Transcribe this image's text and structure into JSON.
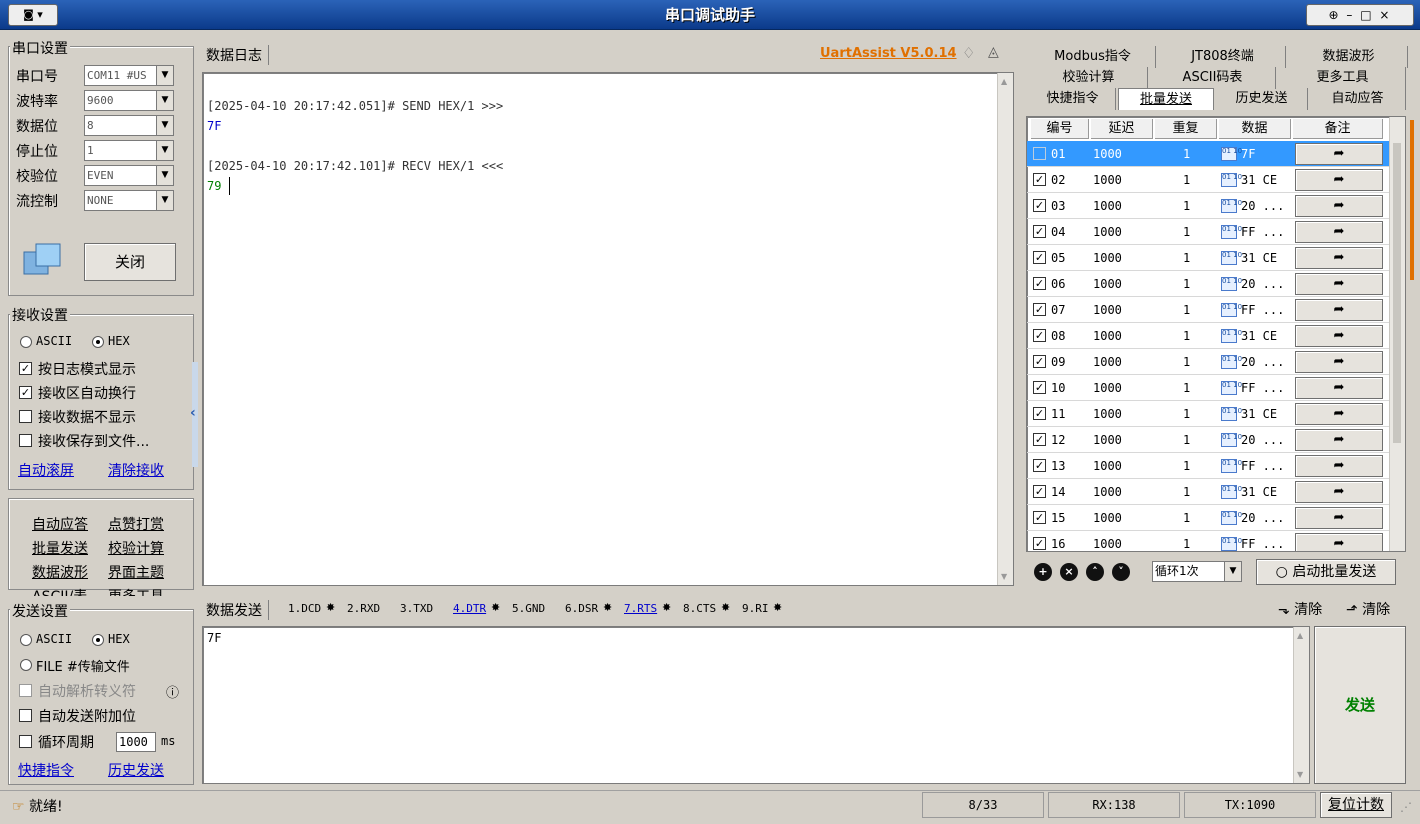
{
  "window": {
    "title": "串口调试助手",
    "icon_menu": "◙ ▾",
    "controls": "⊕ – □ ×"
  },
  "serial_settings": {
    "title": "串口设置",
    "fields": [
      {
        "label": "串口号",
        "value": "COM11 #US"
      },
      {
        "label": "波特率",
        "value": "9600"
      },
      {
        "label": "数据位",
        "value": "8"
      },
      {
        "label": "停止位",
        "value": "1"
      },
      {
        "label": "校验位",
        "value": "EVEN"
      },
      {
        "label": "流控制",
        "value": "NONE"
      }
    ],
    "close_button": "关闭"
  },
  "receive_settings": {
    "title": "接收设置",
    "ascii_label": "ASCII",
    "hex_label": "HEX",
    "selected": "HEX",
    "options": [
      {
        "label": "按日志模式显示",
        "checked": true
      },
      {
        "label": "接收区自动换行",
        "checked": true
      },
      {
        "label": "接收数据不显示",
        "checked": false
      },
      {
        "label": "接收保存到文件...",
        "checked": false
      }
    ],
    "link_autoscroll": "自动滚屏",
    "link_clear": "清除接收"
  },
  "tools_links": {
    "row1": [
      "自动应答",
      "点赞打赏"
    ],
    "row2": [
      "批量发送",
      "校验计算"
    ],
    "row3": [
      "数据波形",
      "界面主题"
    ],
    "row4": [
      "ASCII/表",
      "更多工具"
    ]
  },
  "send_settings": {
    "title": "发送设置",
    "ascii_label": "ASCII",
    "hex_label": "HEX",
    "selected": "HEX",
    "file_label": "FILE #传输文件",
    "auto_escape": "自动解析转义符",
    "append_checksum": "自动发送附加位",
    "cycle_label": "循环周期",
    "cycle_value": "1000",
    "cycle_unit": "ms",
    "link_quick": "快捷指令",
    "link_history": "历史发送"
  },
  "log": {
    "tab": "数据日志",
    "brand": "UartAssist V5.0.14",
    "lines": [
      {
        "text": "[2025-04-10 20:17:42.051]# SEND HEX/1 >>>",
        "kind": "header"
      },
      {
        "text": "7F",
        "kind": "send"
      },
      {
        "text": "[2025-04-10 20:17:42.101]# RECV HEX/1 <<<",
        "kind": "header"
      },
      {
        "text": "79",
        "kind": "recv"
      }
    ]
  },
  "send_area": {
    "tab": "数据发送",
    "signals": [
      {
        "label": "1.DCD",
        "dot": true,
        "link": false
      },
      {
        "label": "2.RXD",
        "dot": false,
        "link": false
      },
      {
        "label": "3.TXD",
        "dot": false,
        "link": false
      },
      {
        "label": "4.DTR",
        "dot": true,
        "link": true
      },
      {
        "label": "5.GND",
        "dot": false,
        "link": false
      },
      {
        "label": "6.DSR",
        "dot": true,
        "link": false
      },
      {
        "label": "7.RTS",
        "dot": true,
        "link": true
      },
      {
        "label": "8.CTS",
        "dot": true,
        "link": false
      },
      {
        "label": "9.RI",
        "dot": true,
        "link": false
      }
    ],
    "clear_send": "清除",
    "clear_recv": "清除",
    "content": "7F",
    "send_button": "发送"
  },
  "right_tabs": {
    "row1": [
      "Modbus指令",
      "JT808终端",
      "数据波形"
    ],
    "row2": [
      "校验计算",
      "ASCII码表",
      "更多工具"
    ],
    "row3": [
      "快捷指令",
      "批量发送",
      "历史发送",
      "自动应答"
    ],
    "active": "批量发送"
  },
  "batch": {
    "headers": [
      "编号",
      "延迟",
      "重复",
      "数据",
      "备注"
    ],
    "rows": [
      {
        "id": "01",
        "delay": "1000",
        "repeat": "1",
        "data": "7F",
        "checked": false,
        "selected": true
      },
      {
        "id": "02",
        "delay": "1000",
        "repeat": "1",
        "data": "31 CE",
        "checked": true
      },
      {
        "id": "03",
        "delay": "1000",
        "repeat": "1",
        "data": "20 ...",
        "checked": true
      },
      {
        "id": "04",
        "delay": "1000",
        "repeat": "1",
        "data": "FF ...",
        "checked": true
      },
      {
        "id": "05",
        "delay": "1000",
        "repeat": "1",
        "data": "31 CE",
        "checked": true
      },
      {
        "id": "06",
        "delay": "1000",
        "repeat": "1",
        "data": "20 ...",
        "checked": true
      },
      {
        "id": "07",
        "delay": "1000",
        "repeat": "1",
        "data": "FF ...",
        "checked": true
      },
      {
        "id": "08",
        "delay": "1000",
        "repeat": "1",
        "data": "31 CE",
        "checked": true
      },
      {
        "id": "09",
        "delay": "1000",
        "repeat": "1",
        "data": "20 ...",
        "checked": true
      },
      {
        "id": "10",
        "delay": "1000",
        "repeat": "1",
        "data": "FF ...",
        "checked": true
      },
      {
        "id": "11",
        "delay": "1000",
        "repeat": "1",
        "data": "31 CE",
        "checked": true
      },
      {
        "id": "12",
        "delay": "1000",
        "repeat": "1",
        "data": "20 ...",
        "checked": true
      },
      {
        "id": "13",
        "delay": "1000",
        "repeat": "1",
        "data": "FF ...",
        "checked": true
      },
      {
        "id": "14",
        "delay": "1000",
        "repeat": "1",
        "data": "31 CE",
        "checked": true
      },
      {
        "id": "15",
        "delay": "1000",
        "repeat": "1",
        "data": "20 ...",
        "checked": true
      },
      {
        "id": "16",
        "delay": "1000",
        "repeat": "1",
        "data": "FF ...",
        "checked": true
      }
    ],
    "loop_select": "循环1次",
    "start_button": "启动批量发送"
  },
  "status": {
    "ready": "就绪!",
    "count": "8/33",
    "rx": "RX:138",
    "tx": "TX:1090",
    "reset": "复位计数"
  },
  "colors": {
    "title_bar": "#1747a0",
    "link": "#0000cc",
    "send_text": "#0000cc",
    "recv_text": "#008000",
    "brand": "#e07000",
    "send_button": "#008000"
  }
}
